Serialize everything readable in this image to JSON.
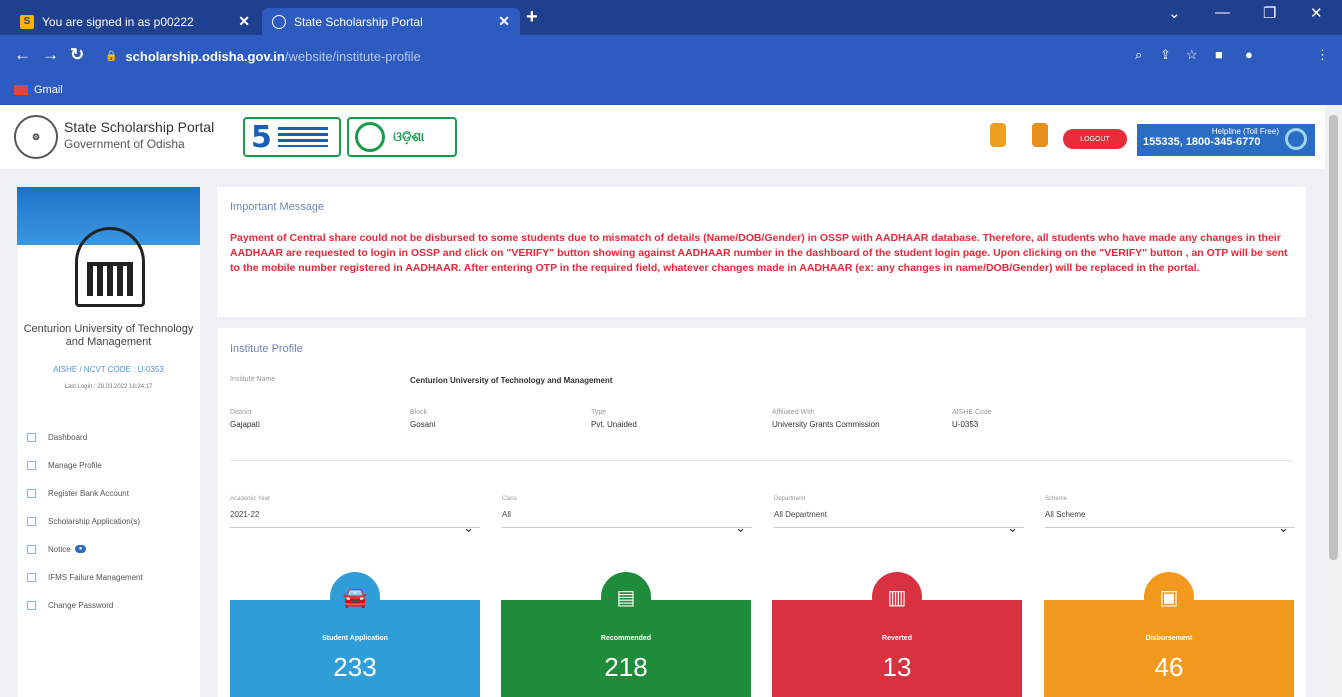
{
  "browser": {
    "tabs": [
      {
        "label": "You are signed in as p00222",
        "favicon": "S"
      },
      {
        "label": "State Scholarship Portal"
      }
    ],
    "url_host": "scholarship.odisha.gov.in",
    "url_path": "/website/institute-profile",
    "bookmark": "Gmail"
  },
  "header": {
    "title": "State Scholarship Portal",
    "subtitle": "Government of Odisha",
    "logo2_text": "ଓଡ଼ିଶା",
    "logout_label": "LOGOUT",
    "helpline_label": "Helpline (Toll Free)",
    "helpline_numbers": "155335, 1800-345-6770"
  },
  "sidebar": {
    "institute_name": "Centurion University of Technology and Management",
    "code": "AISHE / NCVT CODE : U-0353",
    "last_login": "Last Login : 28.03.2022 18:24:17",
    "menu": [
      {
        "label": "Dashboard"
      },
      {
        "label": "Manage Profile"
      },
      {
        "label": "Register Bank Account"
      },
      {
        "label": "Scholarship Application(s)"
      },
      {
        "label": "Notice"
      },
      {
        "label": "IFMS Failure Management"
      },
      {
        "label": "Change Password"
      }
    ]
  },
  "message": {
    "label": "Important Message",
    "text": "Payment of Central share could not be disbursed to some students due to mismatch of details (Name/DOB/Gender) in OSSP with AADHAAR database. Therefore, all students who have made any changes in their AADHAAR are requested to login in OSSP and click on \"VERIFY\" button showing against AADHAAR number in the dashboard of the student login page. Upon clicking on the \"VERIFY\" button , an OTP will be sent to the mobile number registered in AADHAAR. After entering OTP in the required field, whatever changes made in AADHAAR (ex: any changes in name/DOB/Gender) will be replaced in the portal."
  },
  "profile": {
    "title": "Institute Profile",
    "institute_name_label": "Institute Name",
    "institute_name": "Centurion University of Technology and Management",
    "district_label": "District",
    "district": "Gajapati",
    "block_label": "Block",
    "block": "Gosani",
    "type_label": "Type",
    "type": "Pvt. Unaided",
    "affiliated_label": "Affiliated With",
    "affiliated": "University Grants Commission",
    "aishe_label": "AISHE Code",
    "aishe": "U-0353"
  },
  "filters": [
    {
      "label": "Academic Year",
      "value": "2021-22"
    },
    {
      "label": "Class",
      "value": "All"
    },
    {
      "label": "Department",
      "value": "All Department"
    },
    {
      "label": "Scheme",
      "value": "All Scheme"
    }
  ],
  "cards": [
    {
      "label": "Student Application",
      "value": "233",
      "color": "#2f9ed8",
      "icon": "car-icon",
      "glyph": "🚘"
    },
    {
      "label": "Recommended",
      "value": "218",
      "color": "#1e8c3a",
      "icon": "calendar-icon",
      "glyph": "▤"
    },
    {
      "label": "Reverted",
      "value": "13",
      "color": "#d8313f",
      "icon": "document-icon",
      "glyph": "▥"
    },
    {
      "label": "Disbursement",
      "value": "46",
      "color": "#f39a1e",
      "icon": "wallet-icon",
      "glyph": "▣"
    }
  ]
}
